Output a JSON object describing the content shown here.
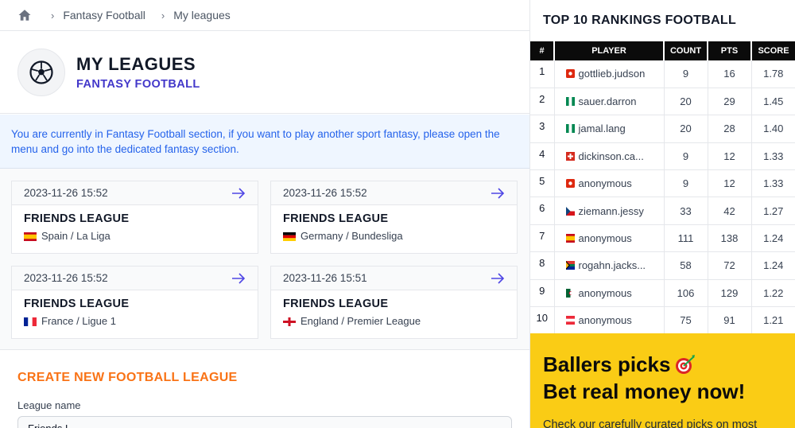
{
  "breadcrumb": {
    "items": [
      "Fantasy Football",
      "My leagues"
    ]
  },
  "header": {
    "title": "MY LEAGUES",
    "subtitle": "FANTASY FOOTBALL"
  },
  "notice": "You are currently in Fantasy Football section, if you want to play another sport fantasy, please open the menu and go into the dedicated fantasy section.",
  "leagues": [
    {
      "date": "2023-11-26 15:52",
      "name": "FRIENDS LEAGUE",
      "competition": "Spain / La Liga",
      "flag": "spain"
    },
    {
      "date": "2023-11-26 15:52",
      "name": "FRIENDS LEAGUE",
      "competition": "Germany / Bundesliga",
      "flag": "germany"
    },
    {
      "date": "2023-11-26 15:52",
      "name": "FRIENDS LEAGUE",
      "competition": "France / Ligue 1",
      "flag": "france"
    },
    {
      "date": "2023-11-26 15:51",
      "name": "FRIENDS LEAGUE",
      "competition": "England / Premier League",
      "flag": "england"
    }
  ],
  "create": {
    "title": "CREATE NEW FOOTBALL LEAGUE",
    "field_label": "League name",
    "field_value": "Friends L"
  },
  "rankings": {
    "title": "TOP 10 RANKINGS FOOTBALL",
    "columns": [
      "#",
      "PLAYER",
      "COUNT",
      "PTS",
      "SCORE"
    ],
    "rows": [
      {
        "rank": "1",
        "player": "gottlieb.judson",
        "flag": "hongkong",
        "count": "9",
        "pts": "16",
        "score": "1.78"
      },
      {
        "rank": "2",
        "player": "sauer.darron",
        "flag": "nigeria",
        "count": "20",
        "pts": "29",
        "score": "1.45"
      },
      {
        "rank": "3",
        "player": "jamal.lang",
        "flag": "nigeria",
        "count": "20",
        "pts": "28",
        "score": "1.40"
      },
      {
        "rank": "4",
        "player": "dickinson.ca...",
        "flag": "switzerland",
        "count": "9",
        "pts": "12",
        "score": "1.33"
      },
      {
        "rank": "5",
        "player": "anonymous",
        "flag": "hongkong",
        "count": "9",
        "pts": "12",
        "score": "1.33"
      },
      {
        "rank": "6",
        "player": "ziemann.jessy",
        "flag": "czech",
        "count": "33",
        "pts": "42",
        "score": "1.27"
      },
      {
        "rank": "7",
        "player": "anonymous",
        "flag": "spain",
        "count": "111",
        "pts": "138",
        "score": "1.24"
      },
      {
        "rank": "8",
        "player": "rogahn.jacks...",
        "flag": "southafrica",
        "count": "58",
        "pts": "72",
        "score": "1.24"
      },
      {
        "rank": "9",
        "player": "anonymous",
        "flag": "algeria",
        "count": "106",
        "pts": "129",
        "score": "1.22"
      },
      {
        "rank": "10",
        "player": "anonymous",
        "flag": "austria",
        "count": "75",
        "pts": "91",
        "score": "1.21"
      }
    ]
  },
  "promo": {
    "line1": "Ballers picks",
    "line2": "Bet real money now!",
    "line3": "Check our carefully curated picks on most"
  },
  "colors": {
    "accent": "#4338ca",
    "orange": "#f97316",
    "notice_bg": "#eff6ff",
    "promo_bg": "#facc15"
  }
}
